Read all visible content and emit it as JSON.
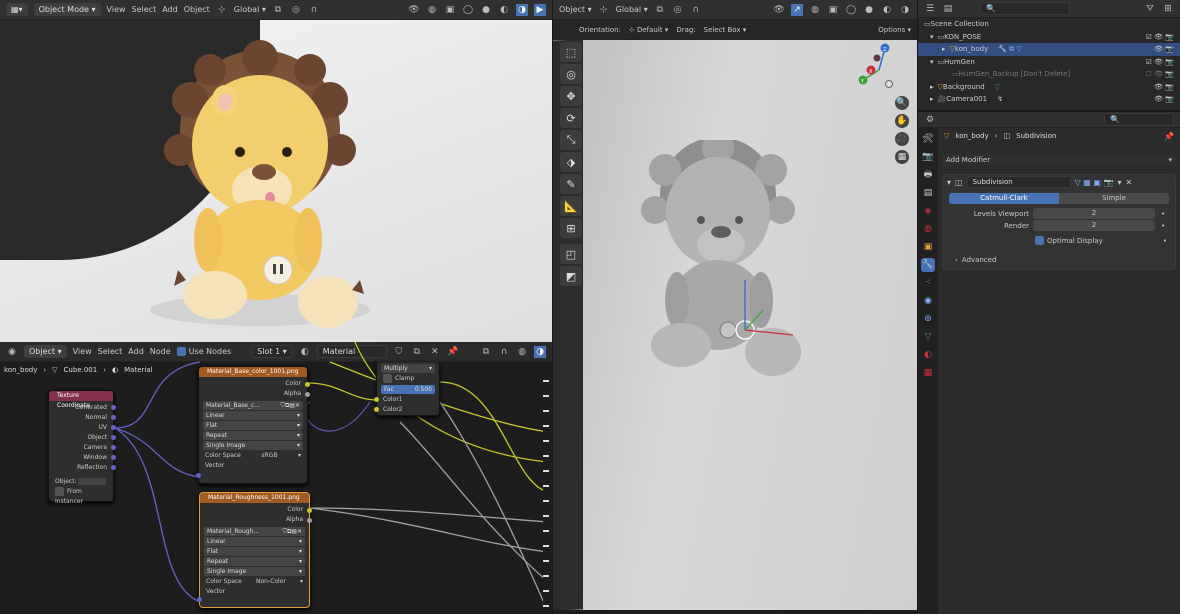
{
  "image_editor": {
    "header": {
      "mode": "Object Mode",
      "menus": [
        "View",
        "Select",
        "Add",
        "Object"
      ],
      "orientation": "Global"
    }
  },
  "viewport": {
    "header": {
      "mode": "Object",
      "orientation": "Global"
    },
    "tool_settings": {
      "orientation_label": "Orientation:",
      "orientation_value": "Default",
      "drag_label": "Drag:",
      "drag_value": "Select Box",
      "options": "Options"
    },
    "gizmo_axes": [
      "X",
      "Y",
      "Z"
    ]
  },
  "node_editor": {
    "header": {
      "mode": "Object",
      "menus": [
        "View",
        "Select",
        "Add",
        "Node"
      ],
      "use_nodes": "Use Nodes",
      "slot": "Slot 1",
      "material": "Material"
    },
    "breadcrumb": [
      "kon_body",
      "Cube.001",
      "Material"
    ],
    "nodes": {
      "texcoord": {
        "title": "Texture Coordinate",
        "outputs": [
          "Generated",
          "Normal",
          "UV",
          "Object",
          "Camera",
          "Window",
          "Reflection"
        ],
        "object_label": "Object:",
        "from_instancer": "From Instancer"
      },
      "base_color": {
        "title": "Material_Base_color_1001.png",
        "outputs": [
          "Color",
          "Alpha"
        ],
        "image": "Material_Base_c...",
        "options": [
          "Linear",
          "Flat",
          "Repeat",
          "Single Image"
        ],
        "colorspace_label": "Color Space",
        "colorspace": "sRGB",
        "input": "Vector"
      },
      "roughness": {
        "title": "Material_Roughness_1001.png",
        "outputs": [
          "Color",
          "Alpha"
        ],
        "image": "Material_Rough...",
        "options": [
          "Linear",
          "Flat",
          "Repeat",
          "Single Image"
        ],
        "colorspace_label": "Color Space",
        "colorspace": "Non-Color",
        "input": "Vector"
      },
      "mix": {
        "blend": "Multiply",
        "clamp": "Clamp",
        "fac_label": "Fac",
        "fac": "0.500",
        "inputs": [
          "Color1",
          "Color2"
        ]
      }
    }
  },
  "outliner": {
    "items": [
      {
        "label": "Scene Collection"
      },
      {
        "label": "KON_POSE"
      },
      {
        "label": "kon_body"
      },
      {
        "label": "HumGen"
      },
      {
        "label": "HumGen_Backup [Don't Delete]"
      },
      {
        "label": "Background"
      },
      {
        "label": "Camera001"
      }
    ]
  },
  "properties": {
    "breadcrumb": [
      "kon_body",
      "Subdivision"
    ],
    "add_modifier": "Add Modifier",
    "modifier": {
      "name": "Subdivision",
      "tabs": [
        "Catmull-Clark",
        "Simple"
      ],
      "levels_label": "Levels Viewport",
      "levels": "2",
      "render_label": "Render",
      "render": "2",
      "optimal": "Optimal Display",
      "advanced": "Advanced"
    }
  },
  "colors": {
    "accent": "#4772b3",
    "texcoord_header": "#83314a",
    "image_header": "#a05a22",
    "selected_node": "#e69d3a",
    "link_yellow": "#c7c729",
    "link_purple": "#6363c7",
    "link_grey": "#a1a1a1"
  }
}
